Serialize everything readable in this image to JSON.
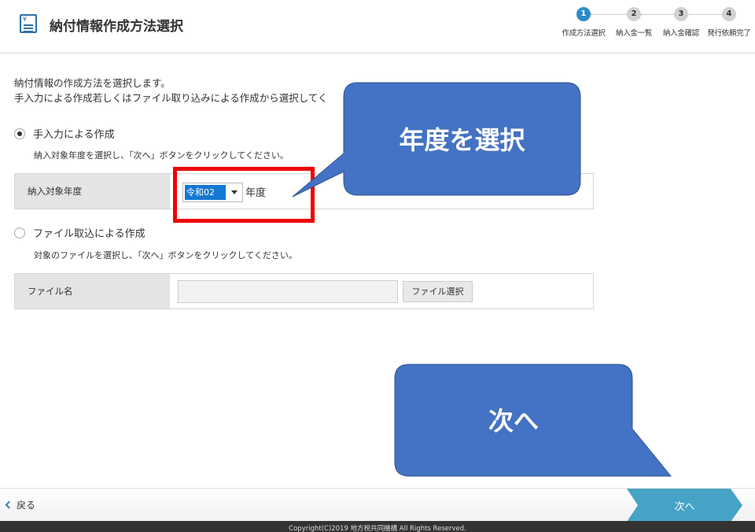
{
  "header": {
    "icon": "document-yen-icon",
    "title": "納付情報作成方法選択",
    "steps": [
      {
        "number": "1",
        "label": "作成方法選択",
        "active": true
      },
      {
        "number": "2",
        "label": "納入金一覧",
        "active": false
      },
      {
        "number": "3",
        "label": "納入金確認",
        "active": false
      },
      {
        "number": "4",
        "label": "発行依頼完了",
        "active": false
      }
    ]
  },
  "main": {
    "intro_line1": "納付情報の作成方法を選択します。",
    "intro_line2": "手入力による作成若しくはファイル取り込みによる作成から選択してく",
    "manual": {
      "label": "手入力による作成",
      "selected": true,
      "description": "納入対象年度を選択し、「次へ」ボタンをクリックしてください。",
      "field_label": "納入対象年度",
      "year_value": "令和02",
      "year_suffix": "年度"
    },
    "file": {
      "label": "ファイル取込による作成",
      "selected": false,
      "description": "対象のファイルを選択し、「次へ」ボタンをクリックしてください。",
      "field_label": "ファイル名",
      "file_value": "",
      "select_button": "ファイル選択"
    }
  },
  "annotations": {
    "callout_year": "年度を選択",
    "callout_next": "次へ",
    "callout_color": "#4472c4",
    "highlight_color": "#ee0000"
  },
  "footer": {
    "back_label": "戻る",
    "next_label": "次へ",
    "next_color": "#46a3c6",
    "copyright": "Copyright(C)2019 地方税共同機構 All Rights Reserved."
  }
}
